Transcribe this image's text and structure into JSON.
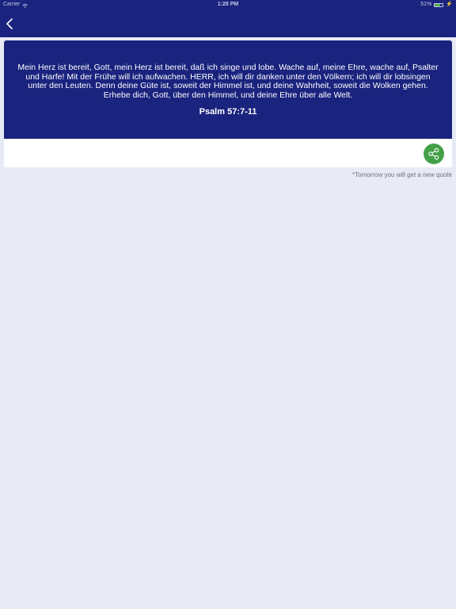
{
  "status_bar": {
    "carrier": "Carrier",
    "time": "1:28 PM",
    "battery": "51%"
  },
  "navigation": {
    "back_icon": "chevron-left-icon"
  },
  "quote": {
    "text": "Mein Herz ist bereit, Gott, mein Herz ist bereit, daß ich singe und lobe. Wache auf, meine Ehre, wache auf, Psalter und Harfe! Mit der Frühe will ich aufwachen. HERR, ich will dir danken unter den Völkern; ich will dir lobsingen unter den Leuten. Denn deine Güte ist, soweit der Himmel ist, und deine Wahrheit, soweit die Wolken gehen. Erhebe dich, Gott, über den Himmel, und deine Ehre über alle Welt.",
    "reference": "Psalm 57:7-11"
  },
  "actions": {
    "share_icon": "share-icon"
  },
  "footnote": "*Tomorrow you will get a new quote",
  "colors": {
    "primary": "#1a237e",
    "background": "#e8eaf6",
    "share": "#43a047",
    "text_on_primary": "#ffffff"
  }
}
